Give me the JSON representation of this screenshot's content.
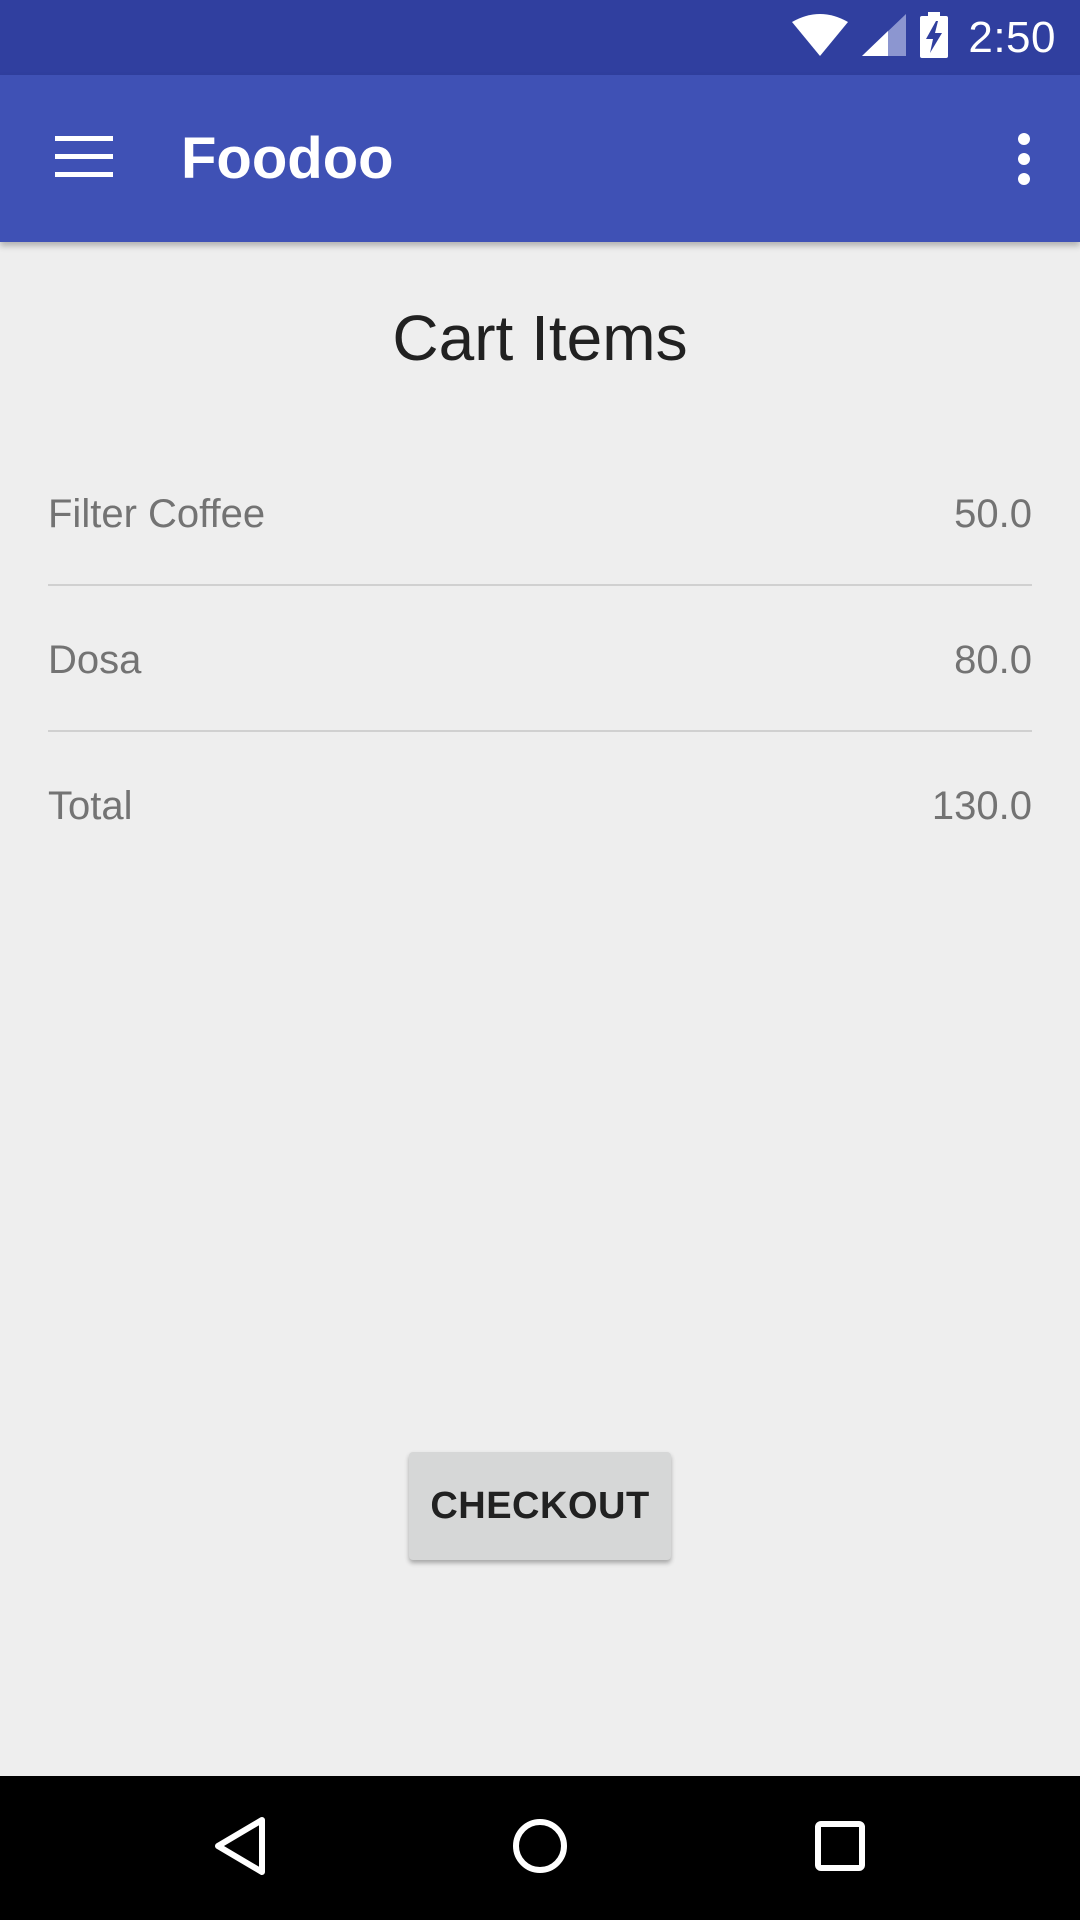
{
  "status_bar": {
    "time": "2:50",
    "icons": [
      "wifi-icon",
      "cell-signal-icon",
      "battery-charging-icon"
    ],
    "background": "#303f9f"
  },
  "app_bar": {
    "title": "Foodoo",
    "menu_icon": "hamburger-menu-icon",
    "overflow_icon": "overflow-menu-icon",
    "background": "#3f51b5"
  },
  "main": {
    "heading": "Cart Items",
    "items": [
      {
        "name": "Filter Coffee",
        "price": "50.0"
      },
      {
        "name": "Dosa",
        "price": "80.0"
      }
    ],
    "total": {
      "label": "Total",
      "value": "130.0"
    },
    "checkout_label": "CHECKOUT"
  },
  "nav_bar": {
    "buttons": [
      "back-icon",
      "home-icon",
      "recents-icon"
    ]
  }
}
